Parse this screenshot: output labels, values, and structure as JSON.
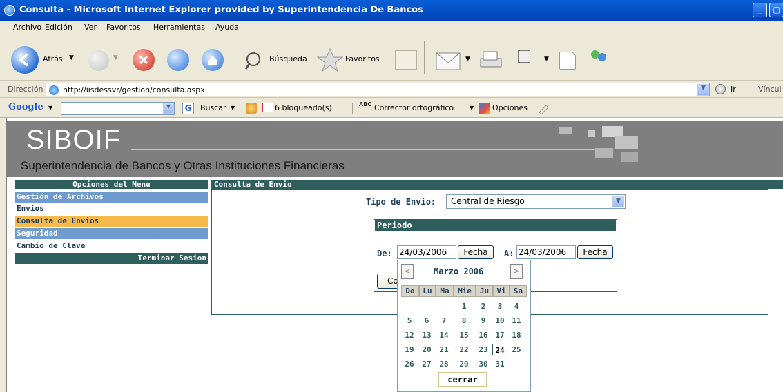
{
  "window": {
    "title": "Consulta - Microsoft Internet Explorer provided by Superintendencia De Bancos"
  },
  "menu": [
    "Archivo",
    "Edición",
    "Ver",
    "Favoritos",
    "Herramientas",
    "Ayuda"
  ],
  "toolbar": {
    "back_label": "Atrás",
    "search_label": "Búsqueda",
    "favorites_label": "Favoritos"
  },
  "address": {
    "label": "Dirección",
    "url": "http://iisdessvr/gestion/consulta.aspx",
    "go_label": "Ir",
    "links_label": "Víncul"
  },
  "google": {
    "brand": "Google",
    "search_label": "Buscar",
    "blocked_label": "6 bloqueado(s)",
    "spell_label": "Corrector ortográfico",
    "options_label": "Opciones"
  },
  "banner": {
    "logo": "SIBOIF",
    "subtitle": "Superintendencia de Bancos y Otras Instituciones Financieras"
  },
  "sidebar": {
    "header": "Opciones del Menu",
    "items": [
      "Gestión de Archivos",
      "Envios",
      "Consulta de Envios",
      "Seguridad",
      "Cambio de Clave"
    ],
    "logout": "Terminar Sesion"
  },
  "panel": {
    "title": "Consulta de Envio",
    "tipo_label": "Tipo de Envio:",
    "tipo_value": "Central de Riesgo",
    "periodo_title": "Periodo",
    "de_label": "De:",
    "de_value": "24/03/2006",
    "fecha_label": "Fecha",
    "a_label": "A:",
    "a_value": "24/03/2006",
    "consultar_partial": "Co"
  },
  "calendar": {
    "month_title": "Marzo 2006",
    "prev": "<",
    "next": ">",
    "days_of_week": [
      "Do",
      "Lu",
      "Ma",
      "Mie",
      "Ju",
      "Vi",
      "Sa"
    ],
    "weeks": [
      [
        "",
        "",
        "",
        "1",
        "2",
        "3",
        "4"
      ],
      [
        "5",
        "6",
        "7",
        "8",
        "9",
        "10",
        "11"
      ],
      [
        "12",
        "13",
        "14",
        "15",
        "16",
        "17",
        "18"
      ],
      [
        "19",
        "20",
        "21",
        "22",
        "23",
        "24",
        "25"
      ],
      [
        "26",
        "27",
        "28",
        "29",
        "30",
        "31",
        ""
      ]
    ],
    "selected": "24",
    "close_label": "cerrar"
  },
  "colors": {
    "header_green": "#2e5f5c",
    "sidebar_blue": "#6f9bcf",
    "sidebar_active": "#f6b94a"
  }
}
